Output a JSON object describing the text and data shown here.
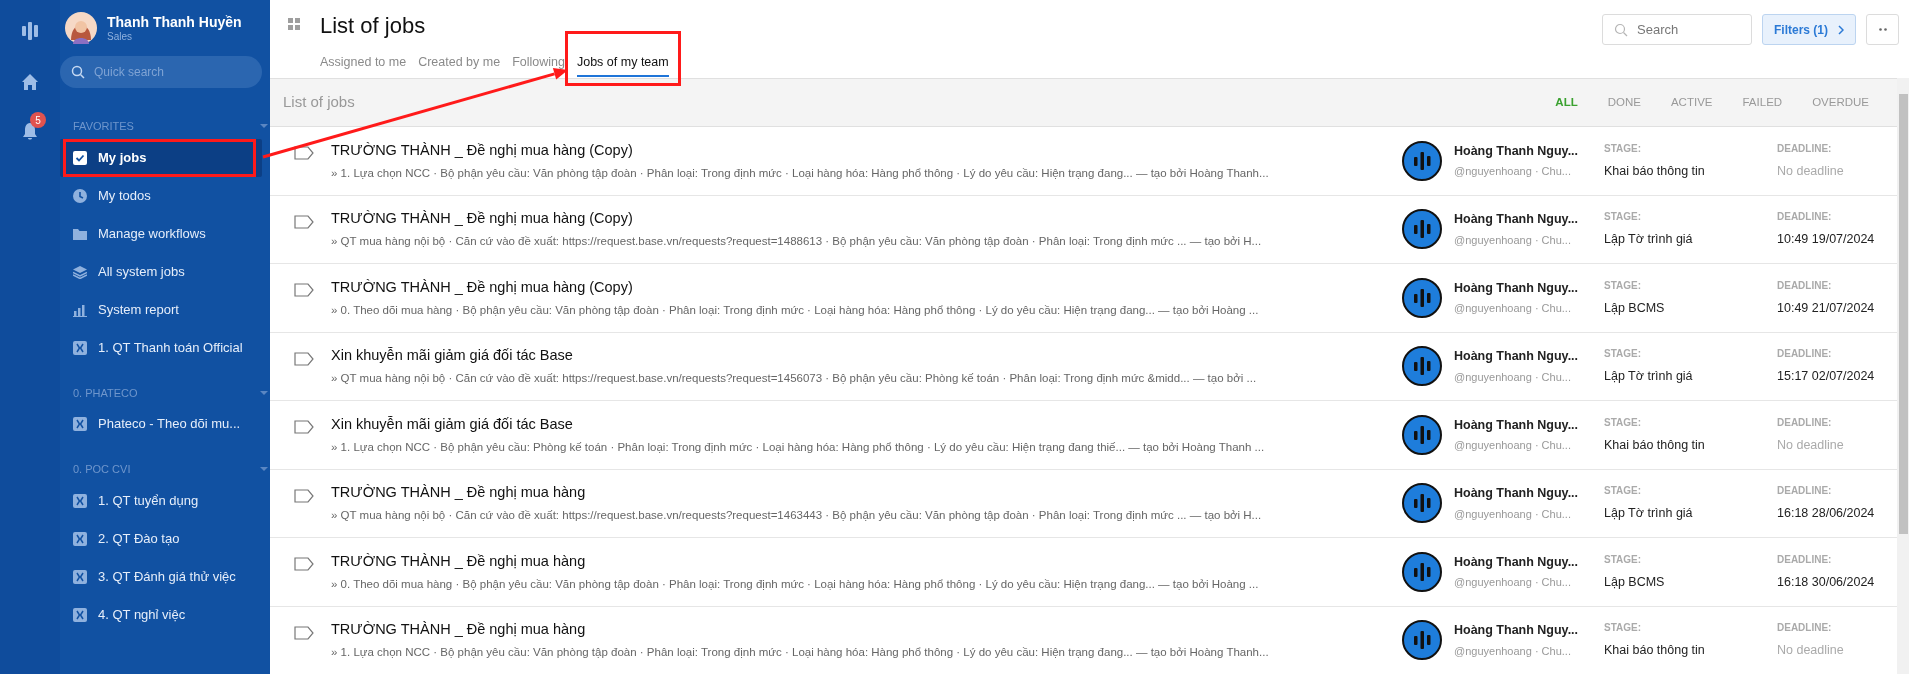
{
  "user": {
    "name": "Thanh Thanh Huyền",
    "role": "Sales"
  },
  "rail": {
    "notification_count": "5"
  },
  "sidebar": {
    "search_placeholder": "Quick search",
    "sections": [
      {
        "title": "FAVORITES",
        "items": [
          {
            "label": "My jobs",
            "kind": "check",
            "selected": true,
            "highlighted": true
          },
          {
            "label": "My todos",
            "kind": "clock",
            "selected": false,
            "highlighted": false
          },
          {
            "label": "Manage workflows",
            "kind": "folder",
            "selected": false,
            "highlighted": false
          },
          {
            "label": "All system jobs",
            "kind": "layers",
            "selected": false,
            "highlighted": false
          },
          {
            "label": "System report",
            "kind": "chart",
            "selected": false,
            "highlighted": false
          },
          {
            "label": "1. QT Thanh toán Official",
            "kind": "workflow",
            "selected": false,
            "highlighted": false
          }
        ]
      },
      {
        "title": "0. PHATECO",
        "items": [
          {
            "label": "Phateco - Theo dõi mu...",
            "kind": "workflow",
            "selected": false,
            "highlighted": false
          }
        ]
      },
      {
        "title": "0. POC CVI",
        "items": [
          {
            "label": "1. QT tuyển dụng",
            "kind": "workflow",
            "selected": false,
            "highlighted": false
          },
          {
            "label": "2. QT Đào tạo",
            "kind": "workflow",
            "selected": false,
            "highlighted": false
          },
          {
            "label": "3. QT Đánh giá thử việc",
            "kind": "workflow",
            "selected": false,
            "highlighted": false
          },
          {
            "label": "4. QT nghỉ việc",
            "kind": "workflow",
            "selected": false,
            "highlighted": false
          }
        ]
      }
    ]
  },
  "header": {
    "title": "List of jobs",
    "tabs": [
      {
        "label": "Assigned to me",
        "selected": false,
        "highlighted": false
      },
      {
        "label": "Created by me",
        "selected": false,
        "highlighted": false
      },
      {
        "label": "Following",
        "selected": false,
        "highlighted": false
      },
      {
        "label": "Jobs of my team",
        "selected": true,
        "highlighted": true
      }
    ],
    "search_placeholder": "Search",
    "filters_button": "Filters (1)"
  },
  "annotation_arrow": true,
  "list": {
    "title": "List of jobs",
    "filters": [
      {
        "label": "ALL",
        "selected": true
      },
      {
        "label": "DONE",
        "selected": false
      },
      {
        "label": "ACTIVE",
        "selected": false
      },
      {
        "label": "FAILED",
        "selected": false
      },
      {
        "label": "OVERDUE",
        "selected": false
      }
    ],
    "rows": [
      {
        "title": "TRƯỜNG THÀNH _ Đề nghị mua hàng (Copy)",
        "subtitle": "» 1. Lựa chọn NCC · Bộ phận yêu cầu: Văn phòng tập đoàn · Phân loại: Trong định mức · Loại hàng hóa: Hàng phổ thông · Lý do yêu cầu: Hiện trạng đang... — tạo bởi Hoàng Thanh...",
        "assignee": "Hoàng Thanh Nguy...",
        "handle": "@nguyenhoang · Chu...",
        "stage_label": "STAGE:",
        "stage": "Khai báo thông tin",
        "deadline_label": "DEADLINE:",
        "deadline": "No deadline",
        "has_deadline": false
      },
      {
        "title": "TRƯỜNG THÀNH _ Đề nghị mua hàng (Copy)",
        "subtitle": "» QT mua hàng nội bộ · Căn cứ vào đề xuất: https://request.base.vn/requests?request=1488613 · Bộ phận yêu cầu: Văn phòng tập đoàn · Phân loại: Trong định mức ... — tạo bởi H...",
        "assignee": "Hoàng Thanh Nguy...",
        "handle": "@nguyenhoang · Chu...",
        "stage_label": "STAGE:",
        "stage": "Lập Tờ trình giá",
        "deadline_label": "DEADLINE:",
        "deadline": "10:49 19/07/2024",
        "has_deadline": true
      },
      {
        "title": "TRƯỜNG THÀNH _ Đề nghị mua hàng (Copy)",
        "subtitle": "» 0. Theo dõi mua hàng · Bộ phận yêu cầu: Văn phòng tập đoàn · Phân loại: Trong định mức · Loại hàng hóa: Hàng phổ thông · Lý do yêu cầu: Hiện trạng đang... — tạo bởi Hoàng ...",
        "assignee": "Hoàng Thanh Nguy...",
        "handle": "@nguyenhoang · Chu...",
        "stage_label": "STAGE:",
        "stage": "Lập BCMS",
        "deadline_label": "DEADLINE:",
        "deadline": "10:49 21/07/2024",
        "has_deadline": true
      },
      {
        "title": "Xin khuyễn mãi giảm giá đối tác Base",
        "subtitle": "» QT mua hàng nội bộ · Căn cứ vào đề xuất: https://request.base.vn/requests?request=1456073 · Bộ phận yêu cầu: Phòng kế toán · Phân loại: Trong định mức &midd... — tạo bởi ...",
        "assignee": "Hoàng Thanh Nguy...",
        "handle": "@nguyenhoang · Chu...",
        "stage_label": "STAGE:",
        "stage": "Lập Tờ trình giá",
        "deadline_label": "DEADLINE:",
        "deadline": "15:17 02/07/2024",
        "has_deadline": true
      },
      {
        "title": "Xin khuyễn mãi giảm giá đối tác Base",
        "subtitle": "» 1. Lựa chọn NCC · Bộ phận yêu cầu: Phòng kế toán · Phân loại: Trong định mức · Loại hàng hóa: Hàng phổ thông · Lý do yêu cầu: Hiện trạng đang thiế... — tạo bởi Hoàng Thanh ...",
        "assignee": "Hoàng Thanh Nguy...",
        "handle": "@nguyenhoang · Chu...",
        "stage_label": "STAGE:",
        "stage": "Khai báo thông tin",
        "deadline_label": "DEADLINE:",
        "deadline": "No deadline",
        "has_deadline": false
      },
      {
        "title": "TRƯỜNG THÀNH _ Đề nghị mua hàng",
        "subtitle": "» QT mua hàng nội bộ · Căn cứ vào đề xuất: https://request.base.vn/requests?request=1463443 · Bộ phận yêu cầu: Văn phòng tập đoàn · Phân loại: Trong định mức ... — tạo bởi H...",
        "assignee": "Hoàng Thanh Nguy...",
        "handle": "@nguyenhoang · Chu...",
        "stage_label": "STAGE:",
        "stage": "Lập Tờ trình giá",
        "deadline_label": "DEADLINE:",
        "deadline": "16:18 28/06/2024",
        "has_deadline": true
      },
      {
        "title": "TRƯỜNG THÀNH _ Đề nghị mua hàng",
        "subtitle": "» 0. Theo dõi mua hàng · Bộ phận yêu cầu: Văn phòng tập đoàn · Phân loại: Trong định mức · Loại hàng hóa: Hàng phổ thông · Lý do yêu cầu: Hiện trạng đang... — tạo bởi Hoàng ...",
        "assignee": "Hoàng Thanh Nguy...",
        "handle": "@nguyenhoang · Chu...",
        "stage_label": "STAGE:",
        "stage": "Lập BCMS",
        "deadline_label": "DEADLINE:",
        "deadline": "16:18 30/06/2024",
        "has_deadline": true
      },
      {
        "title": "TRƯỜNG THÀNH _ Đề nghị mua hàng",
        "subtitle": "» 1. Lựa chọn NCC · Bộ phận yêu cầu: Văn phòng tập đoàn · Phân loại: Trong định mức · Loại hàng hóa: Hàng phổ thông · Lý do yêu cầu: Hiện trạng đang... — tạo bởi Hoàng Thanh...",
        "assignee": "Hoàng Thanh Nguy...",
        "handle": "@nguyenhoang · Chu...",
        "stage_label": "STAGE:",
        "stage": "Khai báo thông tin",
        "deadline_label": "DEADLINE:",
        "deadline": "No deadline",
        "has_deadline": false
      }
    ]
  }
}
